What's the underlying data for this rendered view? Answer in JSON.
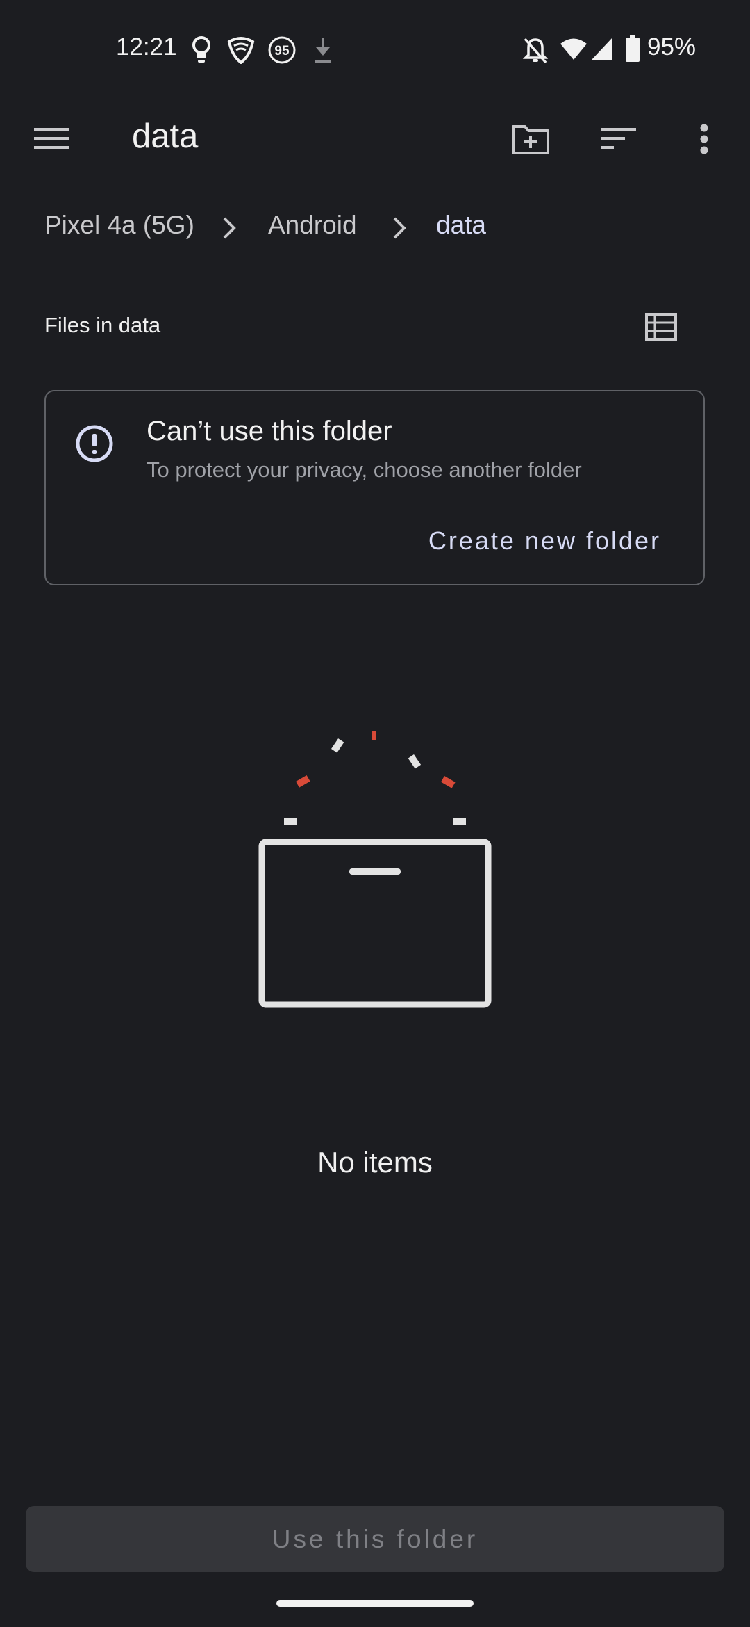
{
  "status_bar": {
    "time": "12:21",
    "battery_percent": "95%",
    "badge_number": "95",
    "icons": [
      "lightbulb-icon",
      "vpn-shield-icon",
      "data-saver-badge-icon",
      "download-icon",
      "notifications-off-icon",
      "wifi-icon",
      "cell-signal-icon",
      "battery-icon"
    ]
  },
  "app_bar": {
    "title": "data",
    "icons": [
      "menu-icon",
      "new-folder-icon",
      "sort-icon",
      "more-vert-icon"
    ]
  },
  "breadcrumb": {
    "items": [
      "Pixel 4a (5G)",
      "Android",
      "data"
    ]
  },
  "section": {
    "files_label": "Files in data",
    "view_toggle_icon": "list-view-icon"
  },
  "warning_card": {
    "icon": "alert-circle-icon",
    "title": "Can’t use this folder",
    "subtitle": "To protect your privacy, choose another folder",
    "action_label": "Create new folder"
  },
  "empty_state": {
    "text": "No items"
  },
  "footer": {
    "use_folder_label": "Use this folder"
  },
  "colors": {
    "background": "#1c1d21",
    "accent": "#d7dbf5",
    "spark_red": "#d84a38"
  }
}
